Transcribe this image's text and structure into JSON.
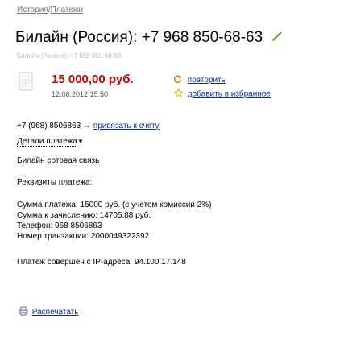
{
  "breadcrumb": {
    "history": "История",
    "separator": "/",
    "payments": "Платежи"
  },
  "title": "Билайн (Россия): +7 968 850-68-63",
  "subtitle": "Билайн (Россия): +7 968 850-68-63",
  "payment": {
    "amount": "15 000,00 руб.",
    "datetime": "12.08.2012 15:50",
    "repeat_label": "повторить",
    "favorite_label": "добавить в избранное"
  },
  "phone": {
    "number": "+7 (968) 8506863",
    "arrow": "→",
    "link_label": "привязать к счету"
  },
  "details_label": "Детали платежа",
  "details": {
    "provider": "Билайн сотовая связь",
    "requisites_label": "Реквизиты платежа:",
    "sum_line": "Сумма платежа: 15000 руб. (с учетом комиссии 2%)",
    "credit_line": "Сумма к зачислению: 14705.88 руб.",
    "phone_line": "Телефон: 968 8506863",
    "transaction_line": "Номер транзакции: 2000049322392",
    "ip_line": "Платеж совершен с IP-адреса: 94.100.17.148"
  },
  "print_label": "Распечатать",
  "colors": {
    "amount": "#cc0000",
    "link": "#0a2bb0",
    "edit": "#5aa02c",
    "repeat_icon": "#e07b00",
    "star": "#e6b800"
  }
}
